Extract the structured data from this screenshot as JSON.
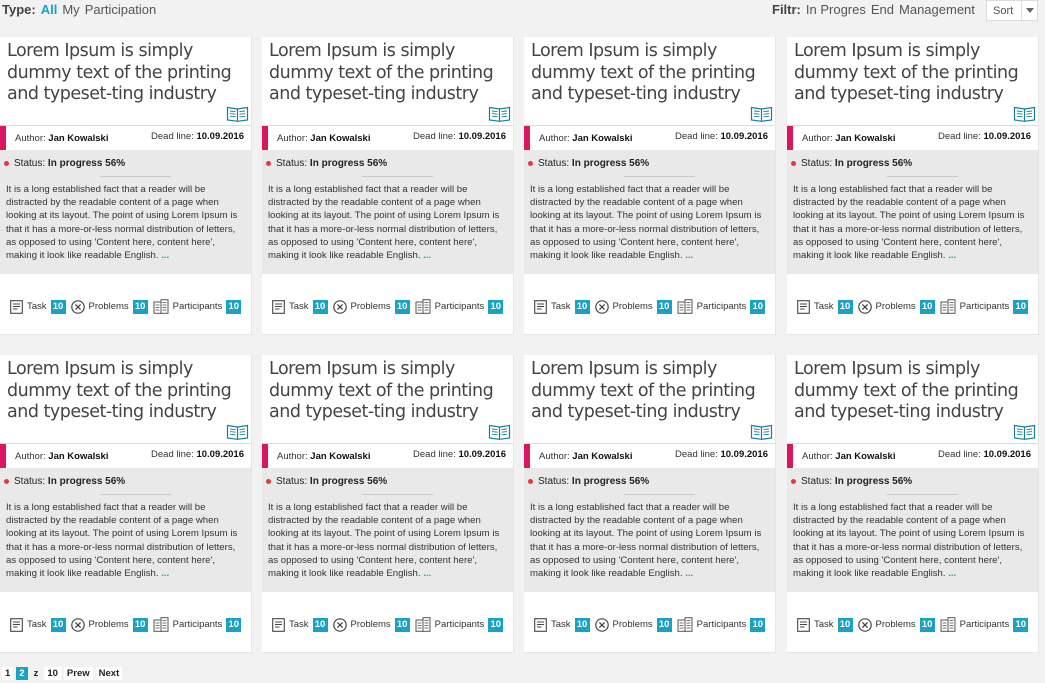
{
  "filters": {
    "type_label": "Type:",
    "type_options": [
      "All",
      "My",
      "Participation"
    ],
    "status_label": "Filtr:",
    "status_options": [
      "In Progres",
      "End",
      "Management"
    ],
    "sort_label": "Sort"
  },
  "cards": [
    {
      "title": "Lorem Ipsum is simply dummy text of the printing and typeset-ting industry",
      "author_label": "Author:",
      "author": "Jan Kowalski",
      "deadline_label": "Dead line:",
      "deadline": "10.09.2016",
      "status_label": "Status:",
      "status": "In progress 56%",
      "description": "It is a long established fact that a reader will be distracted by the readable content of a page when looking at its layout. The point of using Lorem Ipsum is that it has a more-or-less normal distribution of letters, as opposed to using 'Content here, content here', making it look like readable English.",
      "more": "...",
      "task_label": "Task",
      "task_count": "10",
      "problems_label": "Problems",
      "problems_count": "10",
      "participants_label": "Participants",
      "participants_count": "10"
    },
    {
      "title": "Lorem Ipsum is simply dummy text of the printing and typeset-ting industry",
      "author_label": "Author:",
      "author": "Jan Kowalski",
      "deadline_label": "Dead line:",
      "deadline": "10.09.2016",
      "status_label": "Status:",
      "status": "In progress 56%",
      "description": "It is a long established fact that a reader will be distracted by the readable content of a page when looking at its layout. The point of using Lorem Ipsum is that it has a more-or-less normal distribution of letters, as opposed to using 'Content here, content here', making it look like readable English.",
      "more": "...",
      "task_label": "Task",
      "task_count": "10",
      "problems_label": "Problems",
      "problems_count": "10",
      "participants_label": "Participants",
      "participants_count": "10"
    },
    {
      "title": "Lorem Ipsum is simply dummy text of the printing and typeset-ting industry",
      "author_label": "Author:",
      "author": "Jan Kowalski",
      "deadline_label": "Dead line:",
      "deadline": "10.09.2016",
      "status_label": "Status:",
      "status": "In progress 56%",
      "description": "It is a long established fact that a reader will be distracted by the readable content of a page when looking at its layout. The point of using Lorem Ipsum is that it has a more-or-less normal distribution of letters, as opposed to using 'Content here, content here', making it look like readable English.",
      "more": "...",
      "task_label": "Task",
      "task_count": "10",
      "problems_label": "Problems",
      "problems_count": "10",
      "participants_label": "Participants",
      "participants_count": "10"
    },
    {
      "title": "Lorem Ipsum is simply dummy text of the printing and typeset-ting industry",
      "author_label": "Author:",
      "author": "Jan Kowalski",
      "deadline_label": "Dead line:",
      "deadline": "10.09.2016",
      "status_label": "Status:",
      "status": "In progress 56%",
      "description": "It is a long established fact that a reader will be distracted by the readable content of a page when looking at its layout. The point of using Lorem Ipsum is that it has a more-or-less normal distribution of letters, as opposed to using 'Content here, content here', making it look like readable English.",
      "more": "...",
      "task_label": "Task",
      "task_count": "10",
      "problems_label": "Problems",
      "problems_count": "10",
      "participants_label": "Participants",
      "participants_count": "10"
    },
    {
      "title": "Lorem Ipsum is simply dummy text of the printing and typeset-ting industry",
      "author_label": "Author:",
      "author": "Jan Kowalski",
      "deadline_label": "Dead line:",
      "deadline": "10.09.2016",
      "status_label": "Status:",
      "status": "In progress 56%",
      "description": "It is a long established fact that a reader will be distracted by the readable content of a page when looking at its layout. The point of using Lorem Ipsum is that it has a more-or-less normal distribution of letters, as opposed to using 'Content here, content here', making it look like readable English.",
      "more": "...",
      "task_label": "Task",
      "task_count": "10",
      "problems_label": "Problems",
      "problems_count": "10",
      "participants_label": "Participants",
      "participants_count": "10"
    },
    {
      "title": "Lorem Ipsum is simply dummy text of the printing and typeset-ting industry",
      "author_label": "Author:",
      "author": "Jan Kowalski",
      "deadline_label": "Dead line:",
      "deadline": "10.09.2016",
      "status_label": "Status:",
      "status": "In progress 56%",
      "description": "It is a long established fact that a reader will be distracted by the readable content of a page when looking at its layout. The point of using Lorem Ipsum is that it has a more-or-less normal distribution of letters, as opposed to using 'Content here, content here', making it look like readable English.",
      "more": "...",
      "task_label": "Task",
      "task_count": "10",
      "problems_label": "Problems",
      "problems_count": "10",
      "participants_label": "Participants",
      "participants_count": "10"
    },
    {
      "title": "Lorem Ipsum is simply dummy text of the printing and typeset-ting industry",
      "author_label": "Author:",
      "author": "Jan Kowalski",
      "deadline_label": "Dead line:",
      "deadline": "10.09.2016",
      "status_label": "Status:",
      "status": "In progress 56%",
      "description": "It is a long established fact that a reader will be distracted by the readable content of a page when looking at its layout. The point of using Lorem Ipsum is that it has a more-or-less normal distribution of letters, as opposed to using 'Content here, content here', making it look like readable English.",
      "more": "...",
      "task_label": "Task",
      "task_count": "10",
      "problems_label": "Problems",
      "problems_count": "10",
      "participants_label": "Participants",
      "participants_count": "10"
    },
    {
      "title": "Lorem Ipsum is simply dummy text of the printing and typeset-ting industry",
      "author_label": "Author:",
      "author": "Jan Kowalski",
      "deadline_label": "Dead line:",
      "deadline": "10.09.2016",
      "status_label": "Status:",
      "status": "In progress 56%",
      "description": "It is a long established fact that a reader will be distracted by the readable content of a page when looking at its layout. The point of using Lorem Ipsum is that it has a more-or-less normal distribution of letters, as opposed to using 'Content here, content here', making it look like readable English.",
      "more": "...",
      "task_label": "Task",
      "task_count": "10",
      "problems_label": "Problems",
      "problems_count": "10",
      "participants_label": "Participants",
      "participants_count": "10"
    }
  ],
  "pagination": {
    "pages": [
      "1",
      "2",
      "z",
      "10"
    ],
    "current": "2",
    "prev_label": "Prew",
    "next_label": "Next"
  },
  "colors": {
    "accent": "#1aa1c4",
    "meta_bar": "#d8175f",
    "status_dot": "#e23a3a"
  },
  "icons": {
    "book": "book-icon",
    "task": "task-icon",
    "problems": "problems-icon",
    "participants": "participants-icon"
  }
}
